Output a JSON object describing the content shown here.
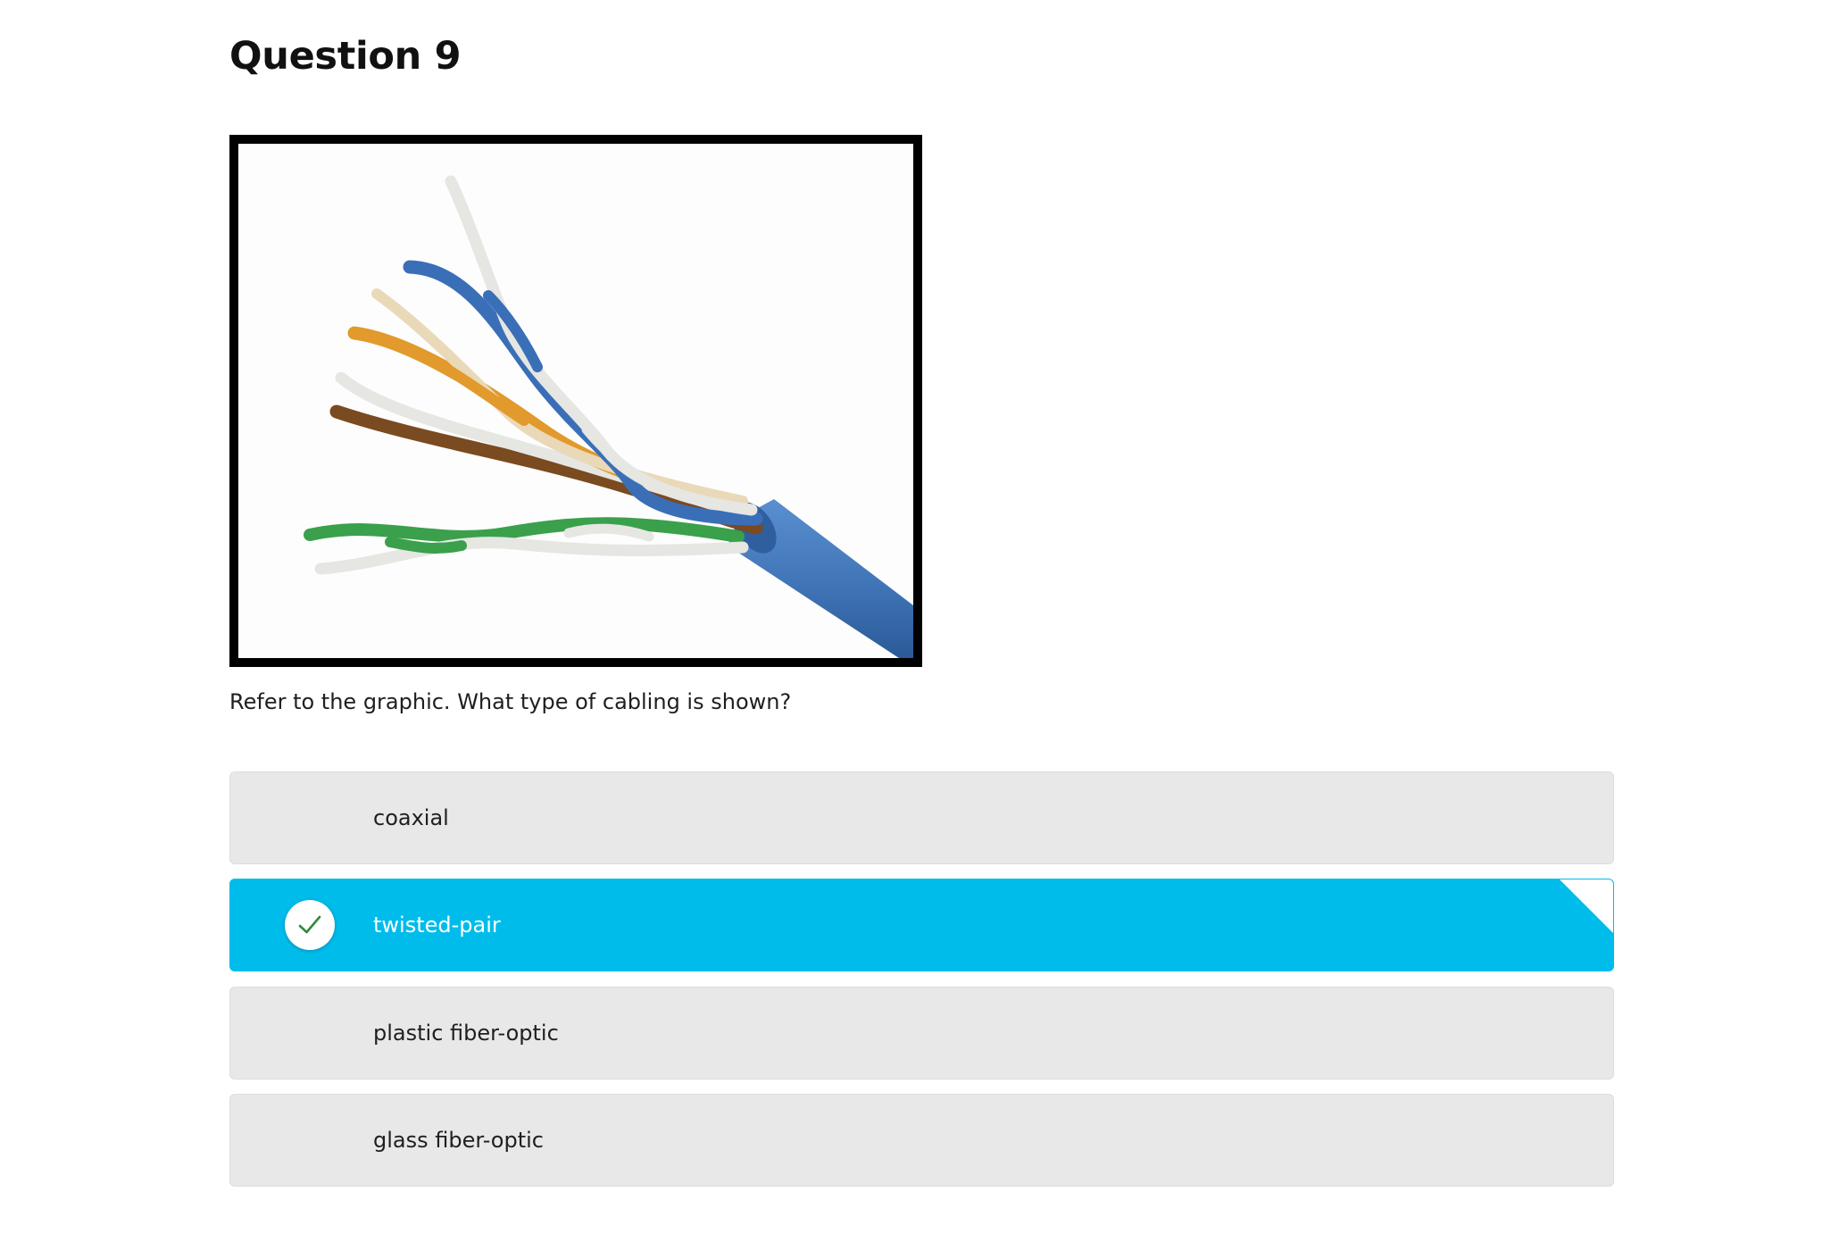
{
  "question": {
    "title": "Question 9",
    "prompt": "Refer to the graphic. What type of cabling is shown?"
  },
  "image": {
    "icon": "twisted-pair-cable-photo",
    "colors": {
      "jacket": "#3f74b6",
      "blue": "#3a6fb8",
      "orange": "#e19a2b",
      "brown": "#7a4a20",
      "green": "#3aa04b",
      "white": "#e6e6e2"
    }
  },
  "options": [
    {
      "label": "coaxial",
      "selected": false
    },
    {
      "label": "twisted-pair",
      "selected": true
    },
    {
      "label": "plastic fiber-optic",
      "selected": false
    },
    {
      "label": "glass fiber-optic",
      "selected": false
    }
  ],
  "colors": {
    "selected": "#00bceb",
    "unselected": "#e8e8e8",
    "check": "#2e8b3a"
  }
}
